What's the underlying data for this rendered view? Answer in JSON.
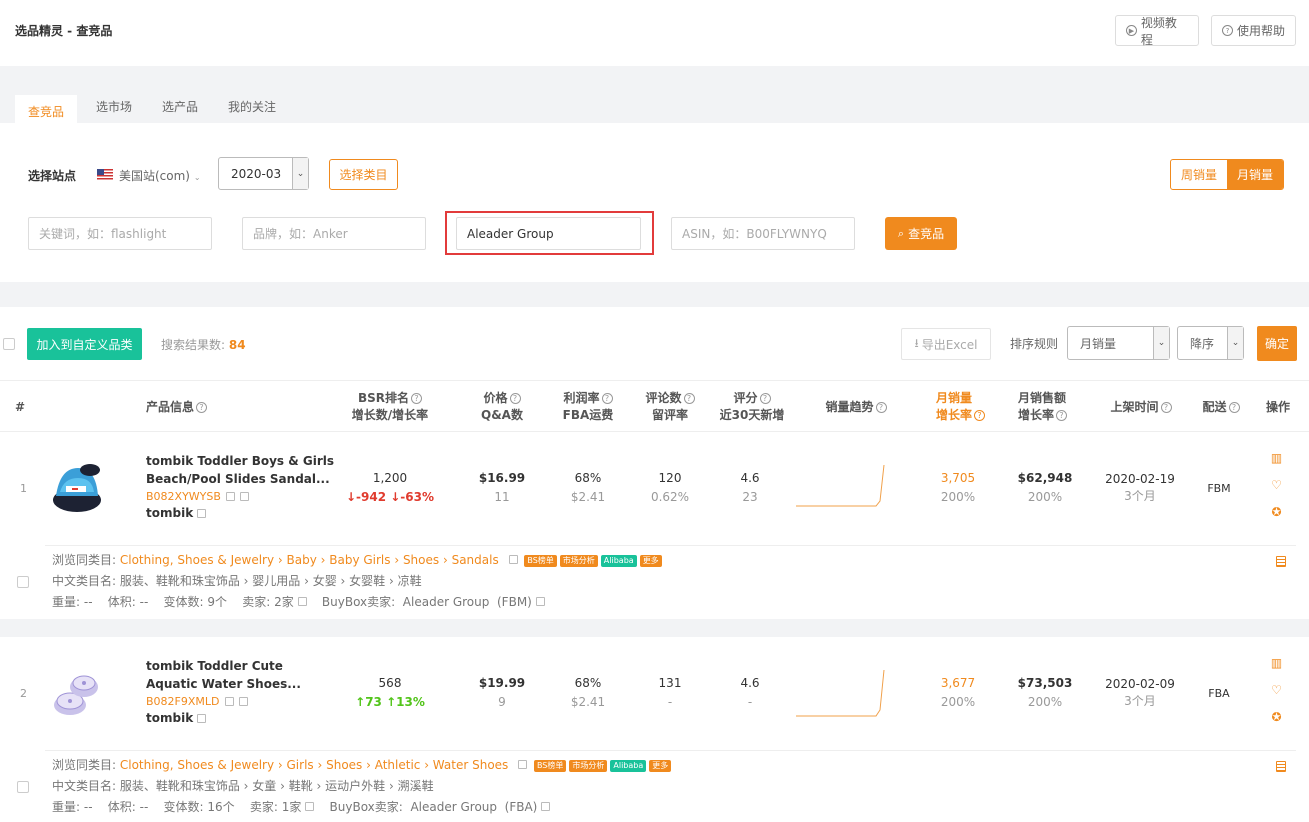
{
  "header": {
    "title": "选品精灵 - 查竞品",
    "video_btn": "视频教程",
    "help_btn": "使用帮助"
  },
  "tabs": [
    "查竞品",
    "选市场",
    "选产品",
    "我的关注"
  ],
  "filters": {
    "site_label": "选择站点",
    "site_value": "美国站(com)",
    "date_value": "2020-03",
    "category_btn": "选择类目",
    "weekly": "周销量",
    "monthly": "月销量",
    "keyword_placeholder": "关键词，如：flashlight",
    "brand_placeholder": "品牌，如：Anker",
    "seller_value": "Aleader Group",
    "asin_placeholder": "ASIN，如：B00FLYWNYQ",
    "search_btn": "查竞品"
  },
  "toolbar": {
    "add_btn": "加入到自定义品类",
    "result_label": "搜索结果数: ",
    "result_count": "84",
    "export_btn": "导出Excel",
    "sort_label": "排序规则",
    "sort_value": "月销量",
    "order_value": "降序",
    "confirm_btn": "确定"
  },
  "columns": {
    "num": "#",
    "product": "产品信息",
    "bsr1": "BSR排名",
    "bsr2": "增长数/增长率",
    "price1": "价格",
    "price2": "Q&A数",
    "profit1": "利润率",
    "profit2": "FBA运费",
    "reviews1": "评论数",
    "reviews2": "留评率",
    "rating1": "评分",
    "rating2": "近30天新增",
    "trend": "销量趋势",
    "sales1": "月销量",
    "sales2": "增长率",
    "revenue1": "月销售额",
    "revenue2": "增长率",
    "listed": "上架时间",
    "ship": "配送",
    "ops": "操作"
  },
  "rows": [
    {
      "index": "1",
      "name1": "tombik Toddler Boys & Girls",
      "name2": "Beach/Pool Slides Sandal...",
      "asin": "B082XYWYSB",
      "brand": "tombik",
      "bsr": "1,200",
      "bsr_change": "↓-942 ↓-63%",
      "price": "$16.99",
      "qa": "11",
      "profit": "68%",
      "fba": "$2.41",
      "reviews": "120",
      "review_rate": "0.62%",
      "rating": "4.6",
      "rating_new": "23",
      "sales": "3,705",
      "sales_growth": "200%",
      "revenue": "$62,948",
      "revenue_growth": "200%",
      "date": "2020-02-19",
      "age": "3个月",
      "ship": "FBM",
      "browse_label": "浏览同类目: ",
      "category_path": "Clothing, Shoes & Jewelry › Baby › Baby Girls › Shoes › Sandals",
      "cn_category": "中文类目名: 服装、鞋靴和珠宝饰品 › 婴儿用品 › 女婴 › 女婴鞋 › 凉鞋",
      "details": "重量: --    体积: --    变体数: 9个    卖家: 2家",
      "buybox": "BuyBox卖家:  Aleader Group  (FBM)"
    },
    {
      "index": "2",
      "name1": "tombik Toddler Cute",
      "name2": "Aquatic Water Shoes...",
      "asin": "B082F9XMLD",
      "brand": "tombik",
      "bsr": "568",
      "bsr_change": "↑73 ↑13%",
      "price": "$19.99",
      "qa": "9",
      "profit": "68%",
      "fba": "$2.41",
      "reviews": "131",
      "review_rate": "-",
      "rating": "4.6",
      "rating_new": "-",
      "sales": "3,677",
      "sales_growth": "200%",
      "revenue": "$73,503",
      "revenue_growth": "200%",
      "date": "2020-02-09",
      "age": "3个月",
      "ship": "FBA",
      "browse_label": "浏览同类目: ",
      "category_path": "Clothing, Shoes & Jewelry › Girls › Shoes › Athletic › Water Shoes",
      "cn_category": "中文类目名: 服装、鞋靴和珠宝饰品 › 女童 › 鞋靴 › 运动户外鞋 › 溯溪鞋",
      "details": "重量: --    体积: --    变体数: 16个    卖家: 1家",
      "buybox": "BuyBox卖家:  Aleader Group  (FBA)"
    }
  ],
  "tags": {
    "bs": "BS榜单",
    "market": "市场分析",
    "alibaba": "Alibaba",
    "more": "更多"
  }
}
